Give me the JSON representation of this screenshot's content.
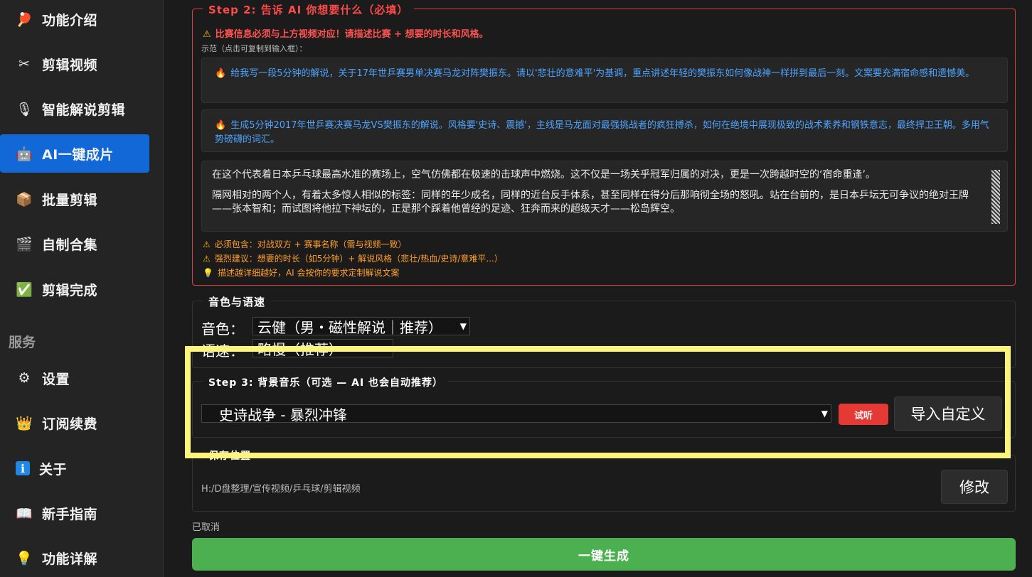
{
  "sidebar": {
    "items": [
      {
        "label": "功能介绍",
        "icon": "ping-pong-icon",
        "glyph": "🏓"
      },
      {
        "label": "剪辑视频",
        "icon": "scissors-icon",
        "glyph": "✂"
      },
      {
        "label": "智能解说剪辑",
        "icon": "narrator-icon",
        "glyph": "🎙"
      },
      {
        "label": "AI一键成片",
        "icon": "robot-icon",
        "glyph": "🤖"
      },
      {
        "label": "批量剪辑",
        "icon": "package-icon",
        "glyph": "📦"
      },
      {
        "label": "自制合集",
        "icon": "clapper-icon",
        "glyph": "🎬"
      },
      {
        "label": "剪辑完成",
        "icon": "check-icon",
        "glyph": "✅"
      }
    ],
    "section_label": "服务",
    "service_items": [
      {
        "label": "设置",
        "icon": "gear-icon",
        "glyph": "⚙"
      },
      {
        "label": "订阅续费",
        "icon": "crown-icon",
        "glyph": "👑"
      },
      {
        "label": "关于",
        "icon": "info-icon",
        "glyph": "ℹ"
      },
      {
        "label": "新手指南",
        "icon": "book-icon",
        "glyph": "📖"
      },
      {
        "label": "功能详解",
        "icon": "bulb-icon",
        "glyph": "💡"
      }
    ],
    "active_index": 3
  },
  "step2": {
    "title": "Step 2: 告诉 AI 你想要什么（必填）",
    "warning": "比赛信息必须与上方视频对应！请描述比赛 + 想要的时长和风格。",
    "example_caption": "示范（点击可复制到输入框）：",
    "examples": [
      "给我写一段5分钟的解说，关于17年世乒赛男单决赛马龙对阵樊振东。请以'悲壮的意难平'为基调，重点讲述年轻的樊振东如何像战神一样拼到最后一刻。文案要充满宿命感和遗憾美。",
      "生成5分钟2017年世乒赛决赛马龙VS樊振东的解说。风格要'史诗、震撼'，主线是马龙面对最强挑战者的疯狂搏杀，如何在绝境中展现极致的战术素养和钢铁意志，最终捍卫王朝。多用气势磅礴的词汇。"
    ],
    "input_paragraphs": [
      "在这个代表着日本乒乓球最高水准的赛场上，空气仿佛都在极速的击球声中燃烧。这不仅是一场关乎冠军归属的对决，更是一次跨越时空的‘宿命重逢’。",
      "隔网相对的两个人，有着太多惊人相似的标签：同样的年少成名，同样的近台反手体系，甚至同样在得分后那响彻全场的怒吼。站在台前的，是日本乒坛无可争议的绝对王牌——张本智和；而试图将他拉下神坛的，正是那个踩着他曾经的足迹、狂奔而来的超级天才——松岛辉空。"
    ],
    "tips": [
      {
        "glyph": "⚠",
        "text": "必须包含：对战双方 + 赛事名称（需与视频一致）"
      },
      {
        "glyph": "⚠",
        "text": "强烈建议：想要的时长（如5分钟）+ 解说风格（悲壮/热血/史诗/意难平...）"
      },
      {
        "glyph": "💡",
        "text": "描述越详细越好，AI 会按你的要求定制解说文案"
      }
    ]
  },
  "voice": {
    "title": "音色与语速",
    "voice_label": "音色：",
    "voice_value": "云健（男・磁性解说｜推荐）",
    "speed_label": "语速：",
    "speed_value": "略慢（推荐）"
  },
  "step3": {
    "title": "Step 3: 背景音乐（可选 — AI 也会自动推荐）",
    "music_value": "史诗战争 - 暴烈冲锋",
    "preview_label": "试听",
    "import_label": "导入自定义"
  },
  "save": {
    "title": "保存位置",
    "path": "H:/D盘整理/宣传视频/乒乓球/剪辑视频",
    "modify_label": "修改"
  },
  "status_text": "已取消",
  "generate_label": "一键生成",
  "colors": {
    "accent": "#1168d6",
    "danger": "#e53935",
    "success": "#4caf50",
    "highlight": "#fdf57a",
    "link": "#4da3ff",
    "tip": "#ff9e2c"
  }
}
